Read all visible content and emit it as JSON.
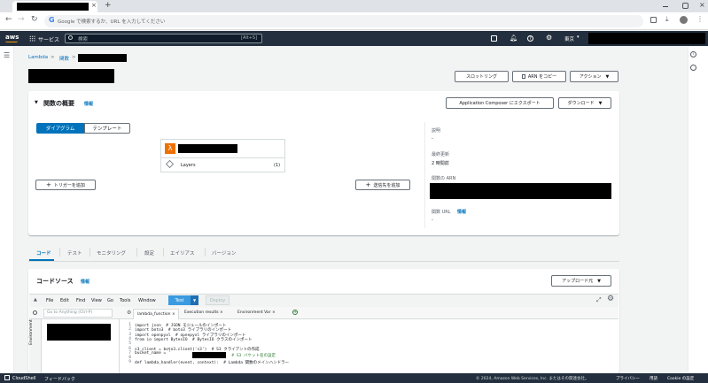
{
  "browser": {
    "tab_close": "×",
    "new_tab": "+",
    "address_placeholder": "Google で検索するか、URL を入力してください"
  },
  "aws": {
    "logo": "aws",
    "services": "サービス",
    "search_placeholder": "検索",
    "shortcut": "[Alt+S]",
    "region": "東京"
  },
  "breadcrumb": {
    "root": "Lambda",
    "sep": ">",
    "functions": "関数"
  },
  "header_buttons": {
    "throttle": "スロットリング",
    "copy_arn": "ARN をコピー",
    "actions": "アクション"
  },
  "overview": {
    "title": "関数の概要",
    "info": "情報",
    "compose_export": "Application Composer にエクスポート",
    "download": "ダウンロード",
    "tab_diagram": "ダイアグラム",
    "tab_template": "テンプレート",
    "layers_label": "Layers",
    "layers_count": "(1)",
    "add_trigger": "トリガーを追加",
    "add_destination": "送信先を追加",
    "desc_label": "説明",
    "desc_value": "-",
    "last_modified_label": "最終更新",
    "last_modified_value": "2 時間前",
    "arn_label": "関数の ARN",
    "url_label": "関数 URL",
    "url_info": "情報",
    "url_value": "-"
  },
  "tabs": [
    "コード",
    "テスト",
    "モニタリング",
    "設定",
    "エイリアス",
    "バージョン"
  ],
  "code_source": {
    "title": "コードソース",
    "info": "情報",
    "upload": "アップロード元",
    "menu": [
      "File",
      "Edit",
      "Find",
      "View",
      "Go",
      "Tools",
      "Window"
    ],
    "test_btn": "Test",
    "deploy_btn": "Deploy",
    "goto_placeholder": "Go to Anything (Ctrl-P)",
    "environment": "Environment",
    "editor_tabs": [
      "lambda_function",
      "Execution results",
      "Environment Var"
    ],
    "lines": [
      "import json  # JSON モジュールのインポート",
      "import boto3  # boto3 ライブラリのインポート",
      "import openpyxl  # openpyxl ライブラリのインポート",
      "from io import BytesIO  # BytesIO クラスのインポート",
      "",
      "s3_client = boto3.client('s3')  # S3 クライアントの作成",
      "bucket_name = '",
      "",
      "def lambda_handler(event, context):  # Lambda 関数のメインハンドラー"
    ],
    "line_suffix": "  # S3 バケット名の設定"
  },
  "footer": {
    "cloudshell": "CloudShell",
    "feedback": "フィードバック",
    "copyright": "© 2024, Amazon Web Services, Inc. またはその関連会社。",
    "privacy": "プライバシー",
    "terms": "用語",
    "cookie": "Cookie の設定"
  }
}
